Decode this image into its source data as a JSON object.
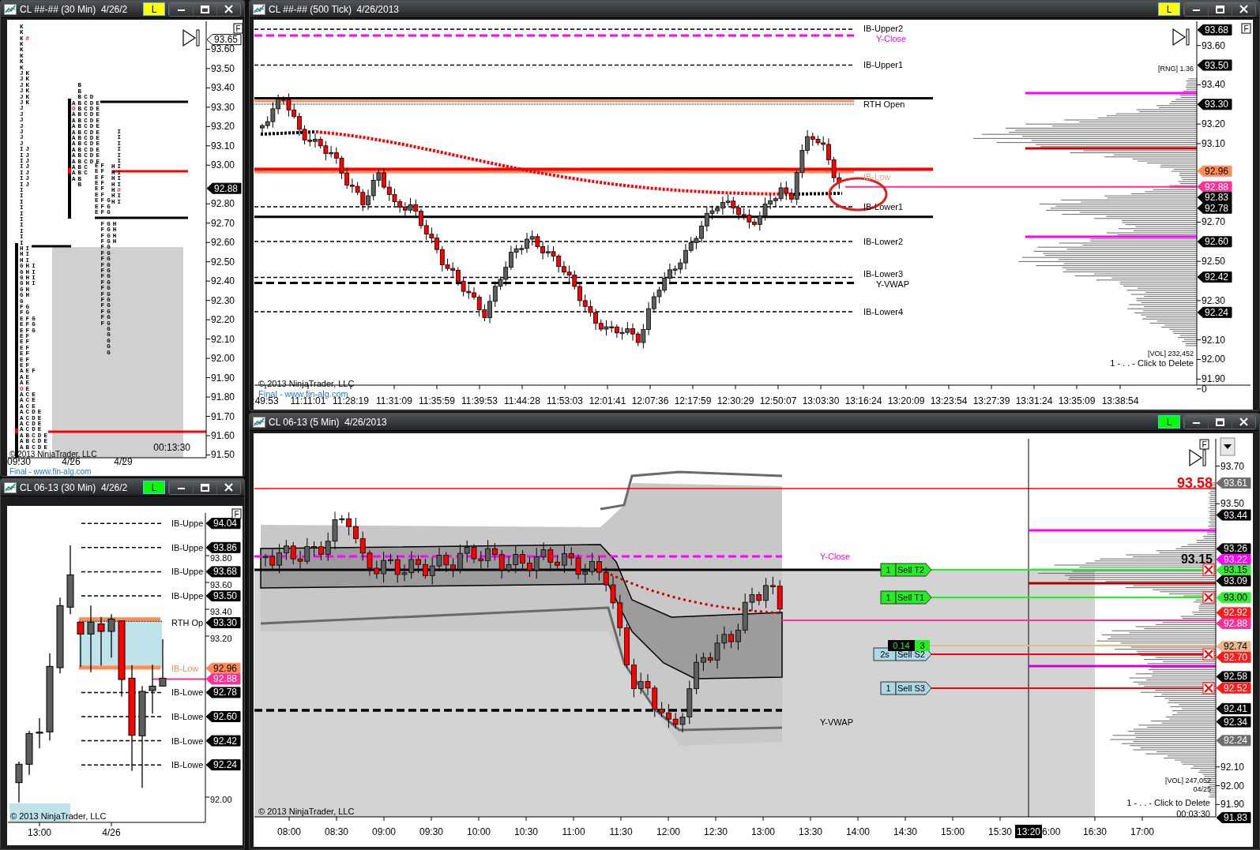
{
  "windows": [
    {
      "kind": "tpo",
      "title": "CL ##-## (30 Min)  4/26/2",
      "link": {
        "label": "L",
        "color": "#ffff00"
      },
      "flag": "F",
      "price_ticks": [
        "93.60",
        "93.50",
        "93.40",
        "93.30",
        "93.20",
        "93.10",
        "93.00",
        "92.80",
        "92.70",
        "92.60",
        "92.50",
        "92.40",
        "92.30",
        "92.20",
        "92.10",
        "92.00",
        "91.90",
        "91.80",
        "91.70",
        "91.60",
        "91.50"
      ],
      "price_tags": [
        {
          "text": "93.65",
          "color": "#ffffff"
        },
        {
          "text": "92.88",
          "color": "#000000"
        }
      ],
      "time_ticks": [
        "09:30",
        "4/26",
        "4/29"
      ],
      "notes": [
        "© 2013 NinjaTrader, LLC",
        "00:13:30"
      ],
      "footer": "Final - www.fin-alg.com",
      "profiles": [
        {
          "rows": [
            "K",
            "K",
            {
              "segments": [
                {
                  "text": "K",
                  "highlight": false
                },
                {
                  "text": "#",
                  "highlight": true
                }
              ]
            },
            "K",
            "K",
            "K",
            "K",
            "K",
            "JK",
            "JK",
            "JK",
            "JK",
            "JK",
            "JK",
            "J",
            "J",
            "J",
            "J",
            "J",
            "J",
            "J",
            "IJ",
            "IJ",
            "IJ",
            "IJ",
            "IJ",
            "IJ",
            "IJ",
            "I",
            "I",
            "I",
            "I",
            "I",
            "I",
            "I",
            "I",
            "I",
            "I",
            "HI",
            "HI",
            "HI",
            "GHI",
            "GHI",
            "GHI",
            "GHI",
            "GH",
            "GH",
            "G",
            "FG",
            "FG",
            "EFG",
            "EFG",
            "EFG",
            "EF",
            "EF",
            "EF",
            "EF",
            "EF",
            "EF",
            "AEF",
            "AE",
            "AE",
            {
              "segments": [
                {
                  "text": "O",
                  "highlight": true
                },
                {
                  "text": "E",
                  "highlight": false
                }
              ]
            },
            "ACE",
            "ACE",
            "ACE",
            "ACDE",
            "ACDE",
            "ACDE",
            "ACDE",
            "ABCDE",
            "ABCDE",
            "ABCDE"
          ]
        },
        {
          "rows": [
            " B",
            " B",
            " BCD",
            "ABCDE",
            {
              "segments": [
                {
                  "text": "O",
                  "highlight": true
                },
                {
                  "text": "BCDE",
                  "highlight": false
                }
              ]
            },
            "ABCDE",
            "ABCDE",
            "ABCDE",
            "ABCDE",
            "ABCDE",
            "ABCDE",
            "ABCDE",
            "ABCDE",
            "ABCDE",
            "ABC",
            "ABC",
            "AB",
            " B"
          ]
        },
        {
          "rows": [
            "EF",
            "EF",
            "EF",
            "EF",
            "EF",
            "EF",
            "EFG",
            "EFG",
            "EFG"
          ]
        },
        {
          "rows": [
            " FGH",
            " FGH",
            " FGH",
            " FGH",
            " FG",
            " FG",
            " FG",
            " FG",
            " FG",
            " FG",
            " FG",
            " FG",
            " FG",
            " FG",
            " FG",
            " FG",
            " FG",
            " FG",
            "  G",
            "  G",
            "  G",
            "  G",
            "  G"
          ]
        },
        {
          "rows": [
            " I",
            " I",
            " I",
            " I",
            " I",
            " I",
            "HI",
            "HI",
            "HI",
            "HI",
            {
              "segments": [
                {
                  "text": "H",
                  "highlight": false
                },
                {
                  "text": "#",
                  "highlight": true
                }
              ]
            },
            "HI",
            "HI"
          ]
        }
      ]
    },
    {
      "kind": "bars",
      "title": "CL 06-13 (30 Min)  4/26/2",
      "link": {
        "label": "L",
        "color": "#00ff00"
      },
      "flag": "F",
      "price_ticks": [
        "93.80",
        "93.60",
        "93.40",
        "93.20",
        "92.00"
      ],
      "price_tags": [
        {
          "text": "94.04",
          "color": "#000000"
        },
        {
          "text": "93.86",
          "color": "#000000"
        },
        {
          "text": "93.68",
          "color": "#000000"
        },
        {
          "text": "93.50",
          "color": "#000000"
        },
        {
          "text": "93.30",
          "color": "#000000"
        },
        {
          "text": "92.96",
          "color": "#ff8c55"
        },
        {
          "text": "92.88",
          "color": "#ff2d96"
        },
        {
          "text": "92.78",
          "color": "#000000"
        },
        {
          "text": "92.60",
          "color": "#000000"
        },
        {
          "text": "92.42",
          "color": "#000000"
        },
        {
          "text": "92.24",
          "color": "#000000"
        }
      ],
      "line_labels": [
        {
          "text": "IB-Uppe",
          "color": "#000000"
        },
        {
          "text": "IB-Uppe",
          "color": "#000000"
        },
        {
          "text": "IB-Uppe",
          "color": "#000000"
        },
        {
          "text": "IB-Uppe",
          "color": "#000000"
        },
        {
          "text": "RTH Op",
          "color": "#000000"
        },
        {
          "text": "IB-Low",
          "color": "#ff8c55"
        },
        {
          "text": "IB-Lowe",
          "color": "#000000"
        },
        {
          "text": "IB-Lowe",
          "color": "#000000"
        },
        {
          "text": "IB-Lowe",
          "color": "#000000"
        },
        {
          "text": "IB-Lowe",
          "color": "#000000"
        }
      ],
      "time_ticks": [
        "13:00",
        "4/26"
      ],
      "notes": [
        "© 2013 NinjaTrader, LLC"
      ]
    },
    {
      "kind": "tick",
      "title": "CL ##-## (500 Tick)  4/26/2013",
      "link": {
        "label": "L",
        "color": "#ffff00"
      },
      "flag": "F",
      "price_ticks": [
        "93.60",
        "93.40",
        "93.20",
        "93.10",
        "92.70",
        "92.50",
        "92.30",
        "92.10",
        "92.00",
        "91.90",
        "0"
      ],
      "price_tags": [
        {
          "text": "93.68",
          "color": "#000000"
        },
        {
          "text": "93.50",
          "color": "#000000"
        },
        {
          "text": "93.30",
          "color": "#000000"
        },
        {
          "text": "92.96",
          "color": "#ff8c55"
        },
        {
          "text": "92.88",
          "color": "#ff2d96"
        },
        {
          "text": "92.83",
          "color": "#000000"
        },
        {
          "text": "92.78",
          "color": "#000000"
        },
        {
          "text": "92.60",
          "color": "#000000"
        },
        {
          "text": "92.42",
          "color": "#000000"
        },
        {
          "text": "92.24",
          "color": "#000000"
        }
      ],
      "line_labels": [
        {
          "text": "IB-Upper2",
          "color": "#000000"
        },
        {
          "text": "Y-Close",
          "color": "#ff00ff"
        },
        {
          "text": "IB-Upper1",
          "color": "#000000"
        },
        {
          "text": "RTH Open",
          "color": "#000000"
        },
        {
          "text": "IB-Low",
          "color": "#ffa07a"
        },
        {
          "text": "IB-Lower1",
          "color": "#000000"
        },
        {
          "text": "IB-Lower2",
          "color": "#000000"
        },
        {
          "text": "IB-Lower3",
          "color": "#000000"
        },
        {
          "text": "Y-VWAP",
          "color": "#000000"
        },
        {
          "text": "IB-Lower4",
          "color": "#000000"
        }
      ],
      "time_ticks": [
        ":49:53",
        "11:11:01",
        "11:28:19",
        "11:31:09",
        "11:35:59",
        "11:39:53",
        "11:44:28",
        "11:53:03",
        "12:01:41",
        "12:07:36",
        "12:17:59",
        "12:30:29",
        "12:50:07",
        "13:03:30",
        "13:16:24",
        "13:20:09",
        "13:23:54",
        "13:27:39",
        "13:31:24",
        "13:35:09",
        "13:38:54"
      ],
      "notes": [
        "[RNG] 1.36",
        "[VOL] 232,452",
        "1 - . . - Click to Delete",
        "© 2013 NinjaTrader, LLC"
      ],
      "footer": "Final - www.fin-alg.com"
    },
    {
      "kind": "minute",
      "title": "CL 06-13 (5 Min)  4/26/2013",
      "link": {
        "label": "L",
        "color": "#00ff00"
      },
      "flag": "F",
      "price_ticks": [
        "93.70",
        "93.50",
        "92.10",
        "92.00",
        "91.90"
      ],
      "price_tags": [
        {
          "text": "93.61",
          "color": "#6e6e6e"
        },
        {
          "text": "93.44",
          "color": "#000000"
        },
        {
          "text": "93.26",
          "color": "#000000"
        },
        {
          "text": "93.22",
          "color": "#ff00ff"
        },
        {
          "text": "93.15",
          "color": "#33ee33"
        },
        {
          "text": "93.09",
          "color": "#000000"
        },
        {
          "text": "93.00",
          "color": "#33ee33"
        },
        {
          "text": "92.92",
          "color": "#ff1a1a"
        },
        {
          "text": "92.88",
          "color": "#ff2d96"
        },
        {
          "text": "92.74",
          "color": "#e8b888"
        },
        {
          "text": "92.70",
          "color": "#ff1a1a"
        },
        {
          "text": "92.58",
          "color": "#000000"
        },
        {
          "text": "92.52",
          "color": "#ff1a1a"
        },
        {
          "text": "92.41",
          "color": "#000000"
        },
        {
          "text": "92.34",
          "color": "#000000"
        },
        {
          "text": "92.24",
          "color": "#6e6e6e"
        },
        {
          "text": "91.83",
          "color": "#000000"
        }
      ],
      "big_prices": [
        {
          "text": "93.58",
          "color": "#ff0000"
        },
        {
          "text": "93.15",
          "color": "#000000"
        }
      ],
      "line_labels": [
        {
          "text": "Y-Close",
          "color": "#ff00ff"
        },
        {
          "text": "Y-VWAP",
          "color": "#000000"
        }
      ],
      "orders": [
        {
          "kind": "target",
          "quantity": "1",
          "label": "Sell T2",
          "color": "#22ee22"
        },
        {
          "kind": "target",
          "quantity": "1",
          "label": "Sell T1",
          "color": "#22ee22"
        },
        {
          "kind": "stop",
          "quantity": "2s",
          "label": "Sell S2",
          "color": "#add8e6"
        },
        {
          "kind": "stop",
          "quantity": "1",
          "label": "Sell S3",
          "color": "#add8e6"
        }
      ],
      "position_badge": {
        "value": "0.14",
        "count": "3"
      },
      "time_ticks": [
        "08:00",
        "08:30",
        "09:00",
        "09:30",
        "10:00",
        "10:30",
        "11:00",
        "11:30",
        "12:00",
        "12:30",
        "13:00",
        "13:30",
        "14:00",
        "14:30",
        "15:00",
        "15:30",
        "6:00",
        "16:30",
        "17:00"
      ],
      "cursor_time": "13:20",
      "notes": [
        "[VOL] 247,052",
        "04/25",
        "1 - . . - Click to Delete",
        "© 2013 NinjaTrader, LLC",
        "00:03:30"
      ]
    }
  ]
}
